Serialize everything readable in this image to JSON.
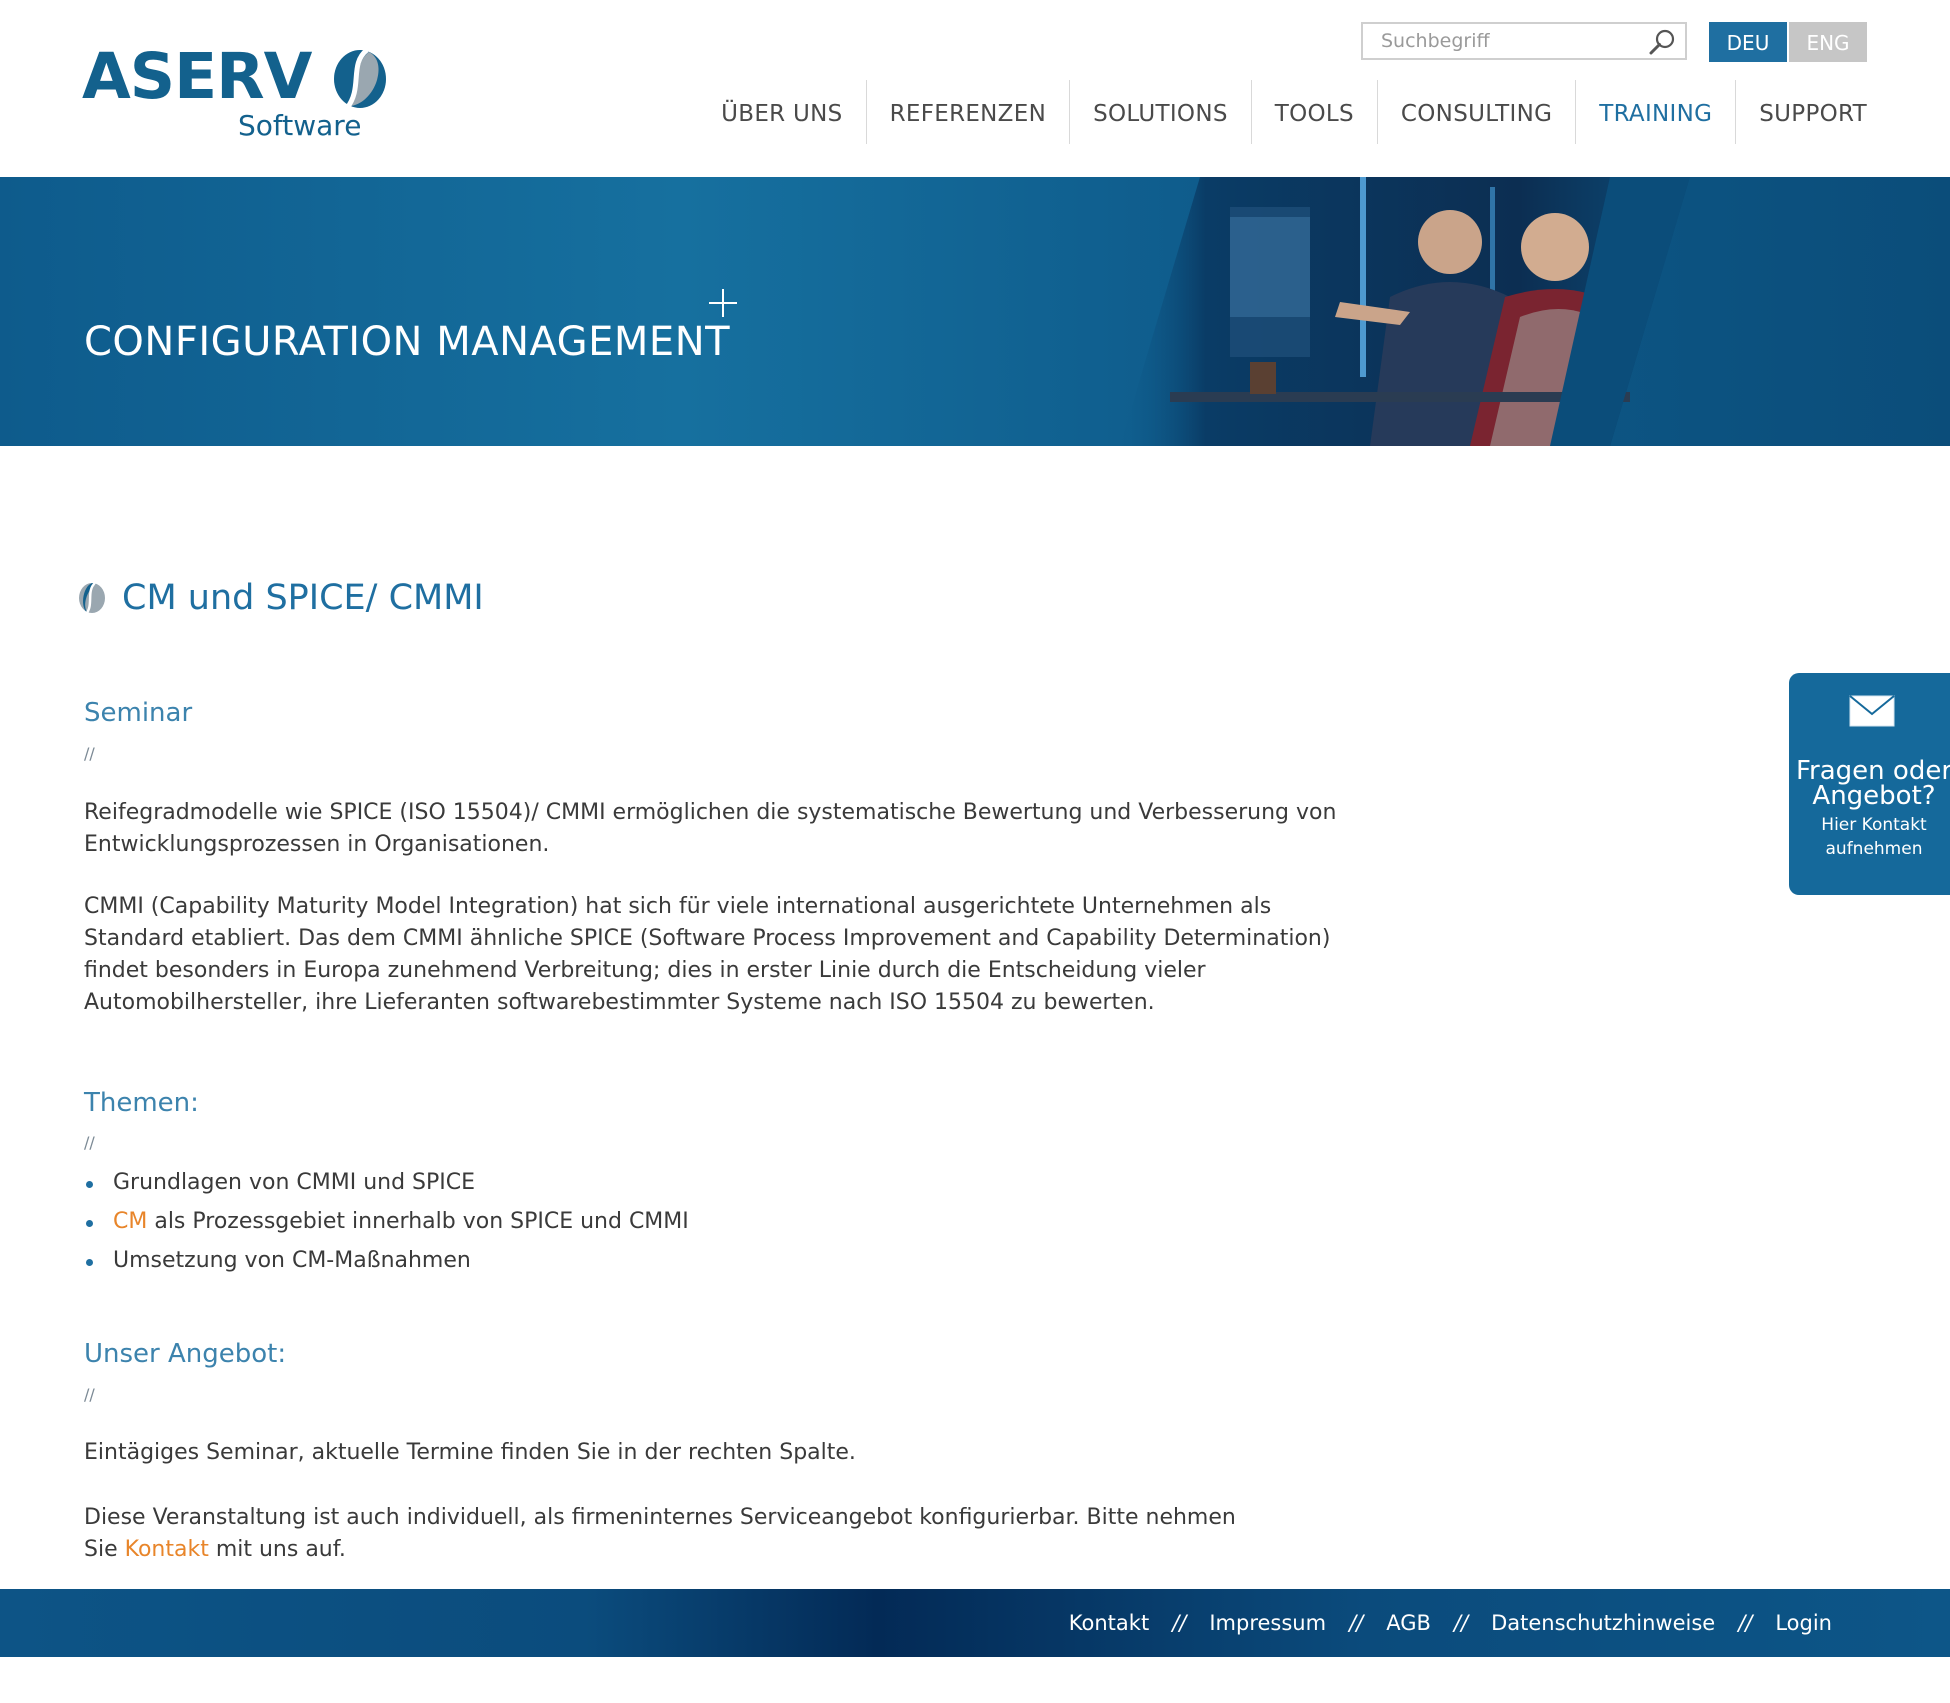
{
  "header": {
    "logo": {
      "word": "ASERV",
      "sub": "Software"
    },
    "search": {
      "placeholder": "Suchbegriff",
      "icon": "search-icon"
    },
    "languages": [
      {
        "label": "DEU",
        "active": true
      },
      {
        "label": "ENG",
        "active": false
      }
    ],
    "nav": [
      {
        "label": "ÜBER UNS"
      },
      {
        "label": "REFERENZEN"
      },
      {
        "label": "SOLUTIONS"
      },
      {
        "label": "TOOLS"
      },
      {
        "label": "CONSULTING"
      },
      {
        "label": "TRAINING",
        "active": true
      },
      {
        "label": "SUPPORT"
      }
    ]
  },
  "banner": {
    "title": "CONFIGURATION MANAGEMENT"
  },
  "main": {
    "heading": "CM und SPICE/ CMMI",
    "seminar": {
      "title": "Seminar",
      "divider": "//",
      "para1": [
        "Reifegradmodelle wie SPICE (ISO 15504)/ CMMI ermöglichen die systematische Bewertung und Verbesserung von",
        "Entwicklungsprozessen in Organisationen."
      ],
      "para2": [
        "CMMI (Capability Maturity Model Integration) hat sich für viele international ausgerichtete Unternehmen als",
        "Standard etabliert. Das dem CMMI ähnliche SPICE (Software Process Improvement and Capability Determination)",
        "findet besonders in Europa zunehmend Verbreitung; dies in erster Linie durch die Entscheidung vieler",
        "Automobilhersteller, ihre Lieferanten softwarebestimmter Systeme nach ISO 15504 zu bewerten."
      ]
    },
    "themen": {
      "title": "Themen:",
      "divider": "//",
      "items": [
        {
          "text": "Grundlagen von CMMI und SPICE"
        },
        {
          "link": "CM",
          "text": " als Prozessgebiet innerhalb von SPICE und CMMI"
        },
        {
          "text": "Umsetzung von CM-Maßnahmen"
        }
      ]
    },
    "angebot": {
      "title": "Unser Angebot:",
      "divider": "//",
      "para1": "Eintägiges Seminar, aktuelle Termine finden Sie in der rechten Spalte.",
      "para2_line1": "Diese Veranstaltung ist auch individuell, als firmeninternes Serviceangebot konfigurierbar. Bitte nehmen",
      "para2_line2_pre": "Sie ",
      "para2_link": "Kontakt",
      "para2_line2_post": " mit uns auf."
    }
  },
  "contact_tab": {
    "icon": "mail-icon",
    "title_line1": "Fragen oder",
    "title_line2": "Angebot?",
    "sub_line1": "Hier Kontakt",
    "sub_line2": "aufnehmen"
  },
  "footer": {
    "links": [
      "Kontakt",
      "Impressum",
      "AGB",
      "Datenschutzhinweise",
      "Login"
    ],
    "separator": "//"
  },
  "colors": {
    "brand_blue": "#1f6fa1",
    "link_orange": "#e8852a",
    "logo_blue": "#13618d"
  }
}
